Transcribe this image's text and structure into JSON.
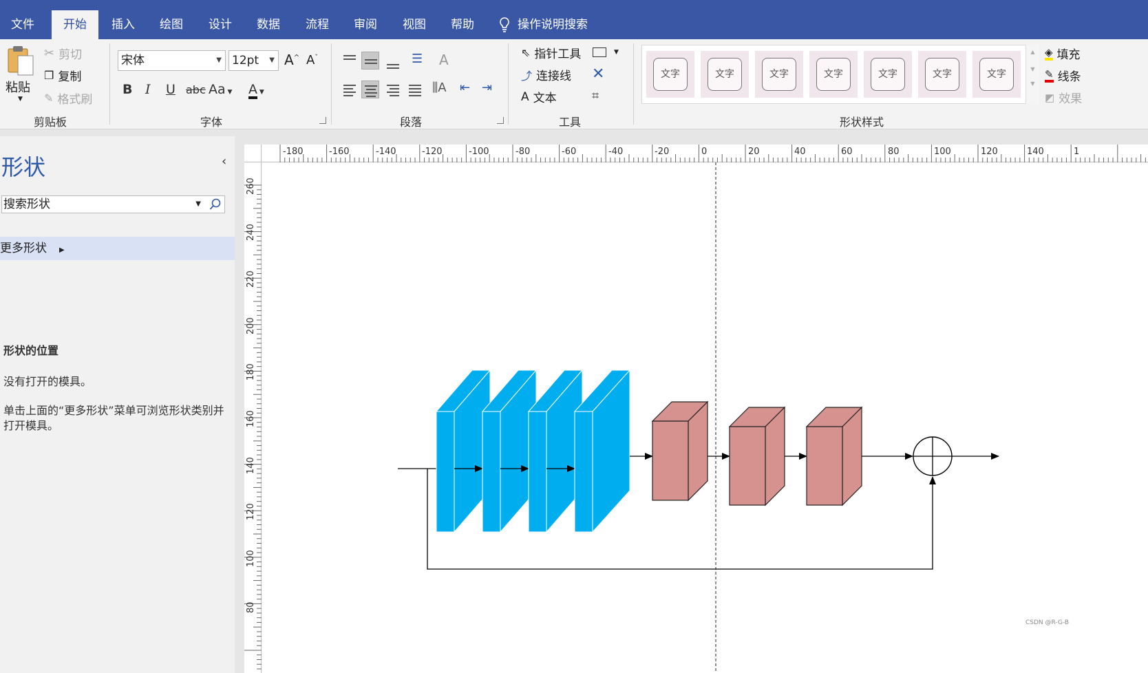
{
  "menu": {
    "tabs": [
      "文件",
      "开始",
      "插入",
      "绘图",
      "设计",
      "数据",
      "流程",
      "审阅",
      "视图",
      "帮助"
    ],
    "active_tab": "开始",
    "tell_me": "操作说明搜索"
  },
  "ribbon": {
    "clipboard": {
      "paste": "粘贴",
      "cut": "剪切",
      "copy": "复制",
      "format_painter": "格式刷",
      "label": "剪贴板"
    },
    "font": {
      "font_name": "宋体",
      "font_size": "12pt",
      "bold": "B",
      "italic": "I",
      "underline": "U",
      "strike": "abc",
      "case": "Aa",
      "color_letter": "A",
      "label": "字体"
    },
    "paragraph": {
      "label": "段落"
    },
    "tools": {
      "pointer": "指针工具",
      "connector": "连接线",
      "text": "文本",
      "text_icon": "A",
      "label": "工具"
    },
    "shape_styles": {
      "tile_text": "文字",
      "tile_count": 7,
      "fill": "填充",
      "line": "线条",
      "effects": "效果",
      "label": "形状样式"
    }
  },
  "shapes_pane": {
    "title": "形状",
    "search_placeholder": "搜索形状",
    "more_shapes": "更多形状",
    "location_heading": "形状的位置",
    "no_stencil": "没有打开的模具。",
    "hint": "单击上面的“更多形状”菜单可浏览形状类别并打开模具。"
  },
  "rulers": {
    "horizontal": [
      "-180",
      "-160",
      "-140",
      "-120",
      "-100",
      "-80",
      "-60",
      "-40",
      "-20",
      "0",
      "20",
      "40",
      "60",
      "80",
      "100",
      "120",
      "140",
      "1"
    ],
    "vertical": [
      "260",
      "240",
      "220",
      "200",
      "180",
      "160",
      "140",
      "120",
      "100",
      "80"
    ]
  },
  "diagram": {
    "blue_blocks": 4,
    "pink_cubes": 3,
    "colors": {
      "blue": "#00adef",
      "pink": "#d6928f",
      "line": "#000000"
    }
  },
  "watermark": "CSDN @R-G-B"
}
